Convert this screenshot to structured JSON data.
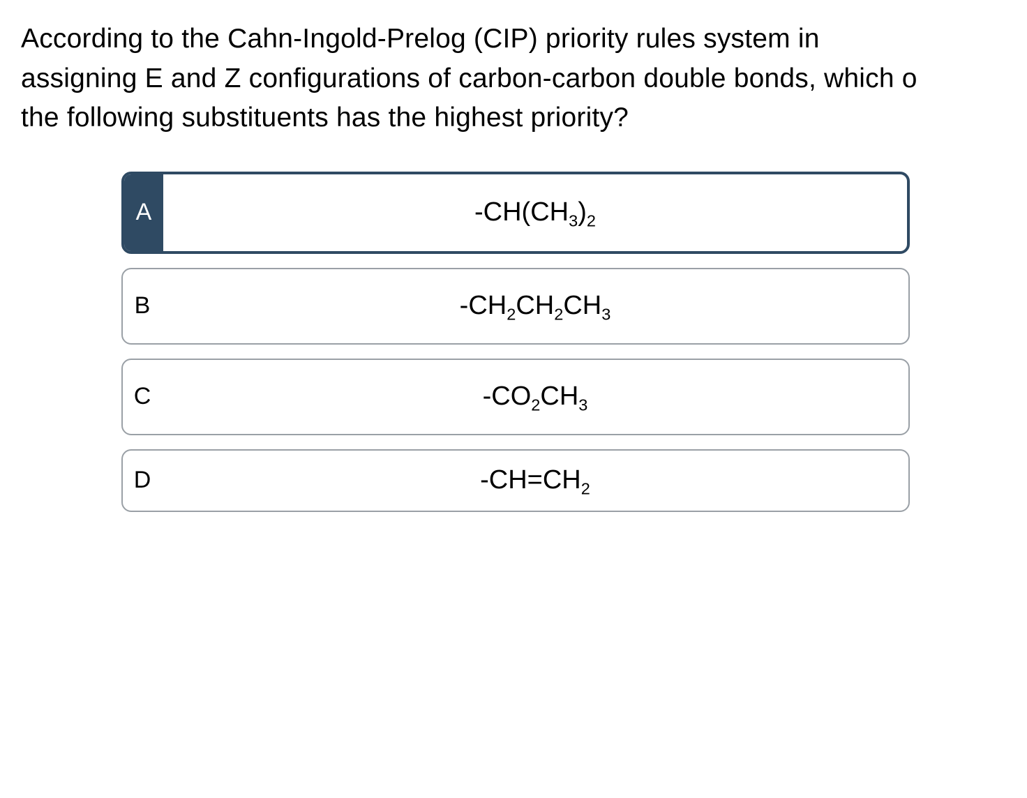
{
  "question": {
    "line1": "According to the Cahn-Ingold-Prelog (CIP) priority rules system in",
    "line2": "assigning E and Z configurations of carbon-carbon double bonds, which o",
    "line3": "the following substituents has the highest priority?"
  },
  "options": [
    {
      "letter": "A",
      "selected": true,
      "formula_parts": [
        "-CH(CH",
        {
          "sub": "3"
        },
        ")",
        {
          "sub": "2"
        }
      ]
    },
    {
      "letter": "B",
      "selected": false,
      "formula_parts": [
        "-CH",
        {
          "sub": "2"
        },
        "CH",
        {
          "sub": "2"
        },
        "CH",
        {
          "sub": "3"
        }
      ]
    },
    {
      "letter": "C",
      "selected": false,
      "formula_parts": [
        "-CO",
        {
          "sub": "2"
        },
        "CH",
        {
          "sub": "3"
        }
      ]
    },
    {
      "letter": "D",
      "selected": false,
      "short": true,
      "formula_parts": [
        "-CH=CH",
        {
          "sub": "2"
        }
      ]
    }
  ]
}
